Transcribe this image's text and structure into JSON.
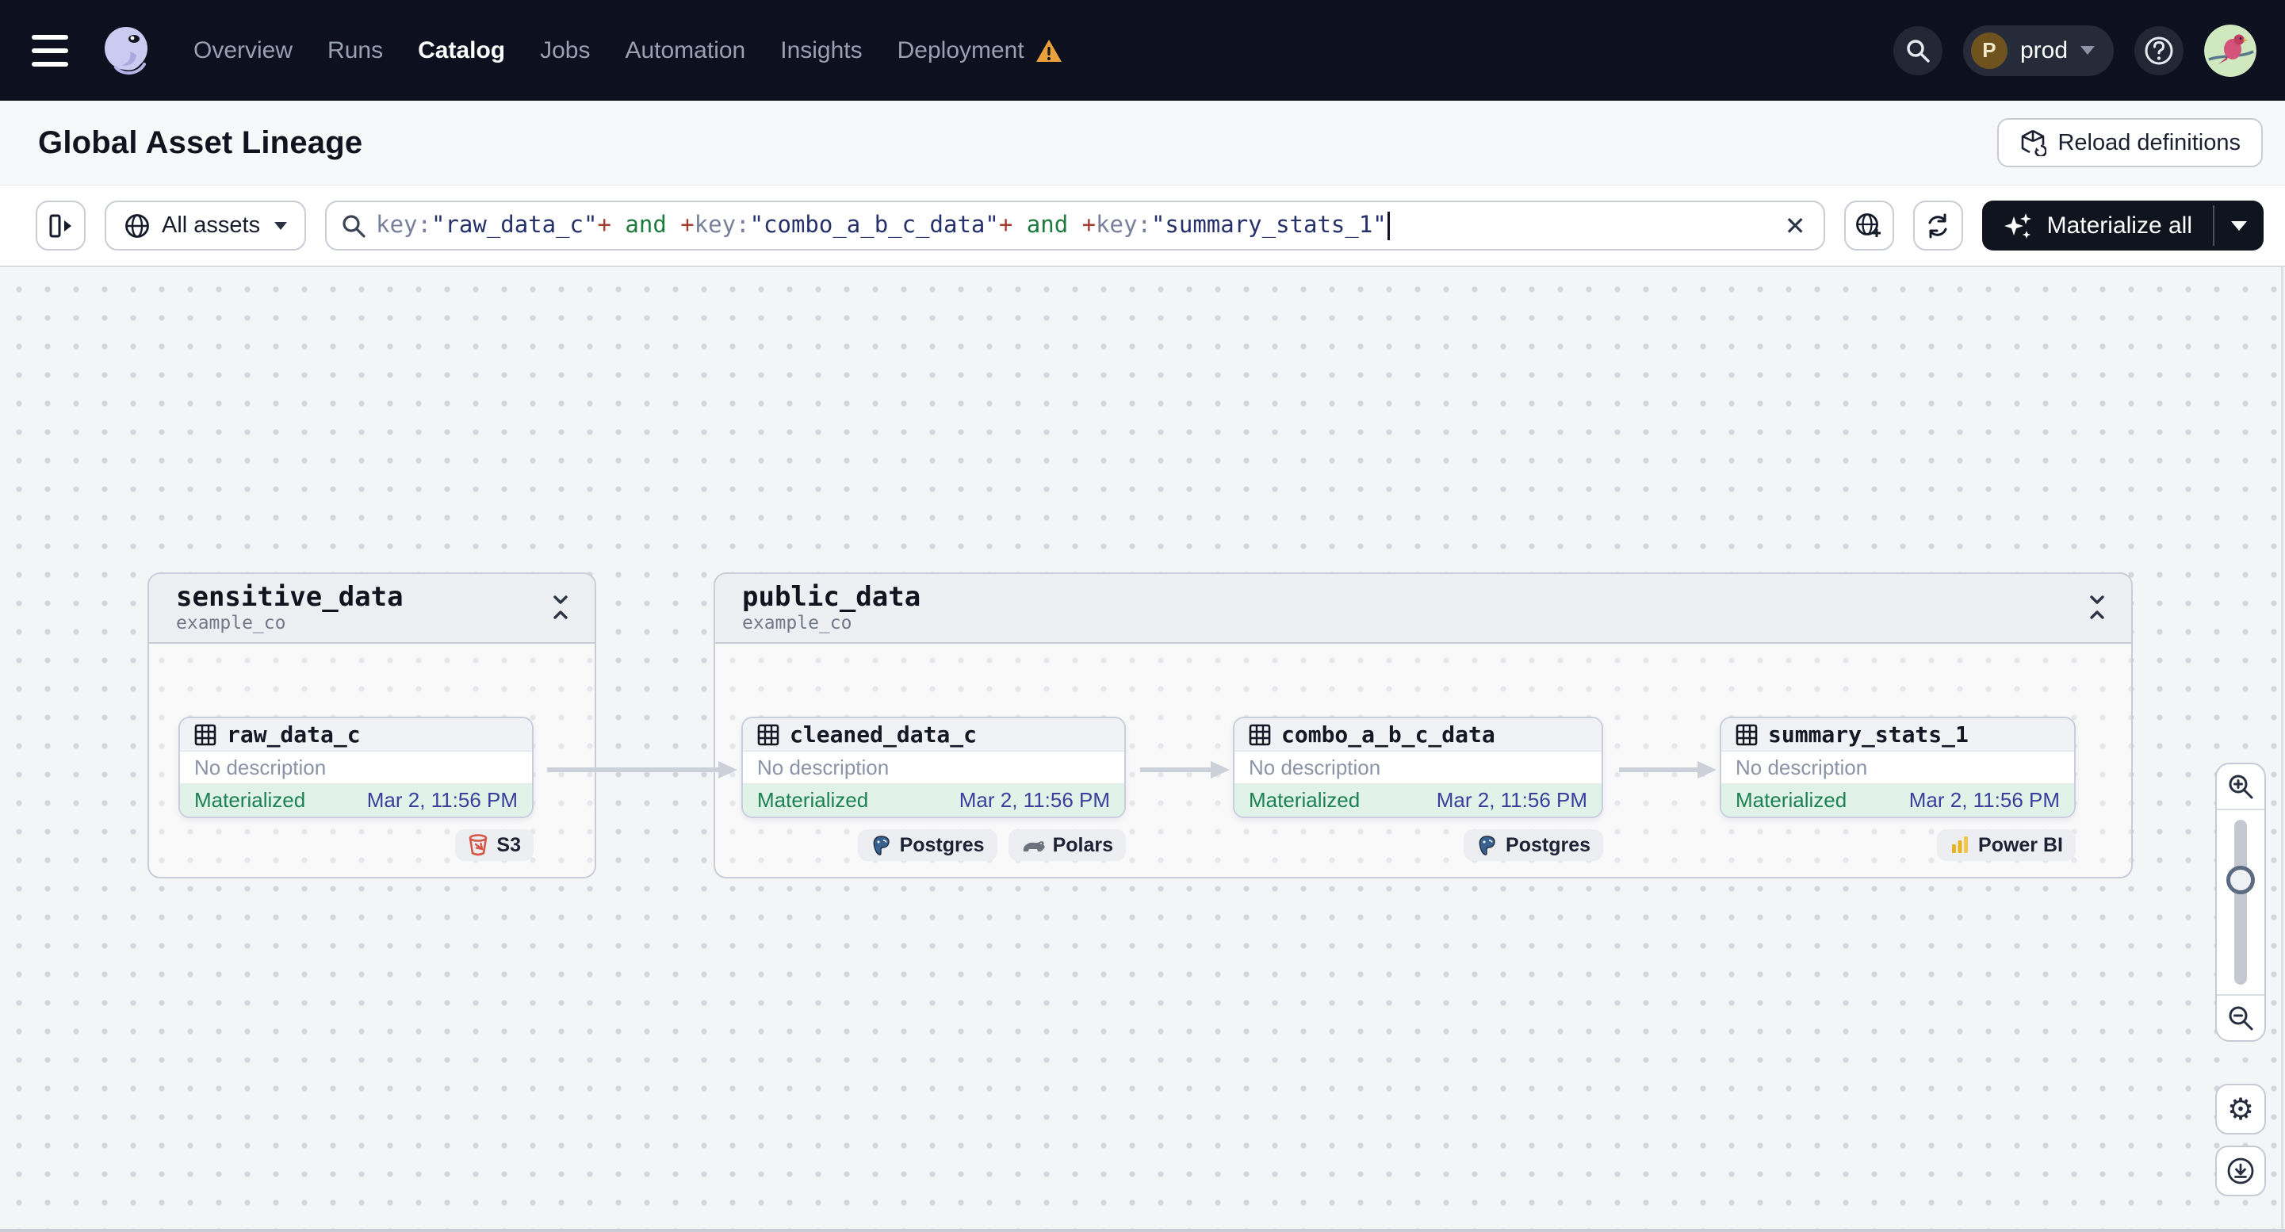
{
  "nav": {
    "items": [
      {
        "label": "Overview"
      },
      {
        "label": "Runs"
      },
      {
        "label": "Catalog"
      },
      {
        "label": "Jobs"
      },
      {
        "label": "Automation"
      },
      {
        "label": "Insights"
      },
      {
        "label": "Deployment"
      }
    ],
    "active_item": "Catalog",
    "deployment_has_warning": true,
    "env": {
      "initial": "P",
      "name": "prod"
    }
  },
  "header": {
    "title": "Global Asset Lineage",
    "reload_label": "Reload definitions"
  },
  "filter": {
    "scope_label": "All assets",
    "clear_glyph": "✕",
    "materialize_label": "Materialize all",
    "query_tokens": [
      {
        "text": "key:",
        "type": "key"
      },
      {
        "text": "\"raw_data_c\"",
        "type": "value"
      },
      {
        "text": "+",
        "type": "plus"
      },
      {
        "text": " and ",
        "type": "and"
      },
      {
        "text": "+",
        "type": "plus"
      },
      {
        "text": "key:",
        "type": "key"
      },
      {
        "text": "\"combo_a_b_c_data\"",
        "type": "value"
      },
      {
        "text": "+",
        "type": "plus"
      },
      {
        "text": " and ",
        "type": "and"
      },
      {
        "text": "+",
        "type": "plus"
      },
      {
        "text": "key:",
        "type": "key"
      },
      {
        "text": "\"summary_stats_1\"",
        "type": "value"
      }
    ]
  },
  "canvas": {
    "groups": [
      {
        "name": "sensitive_data",
        "repo": "example_co"
      },
      {
        "name": "public_data",
        "repo": "example_co"
      }
    ],
    "nodes": [
      {
        "name": "raw_data_c",
        "description": "No description",
        "status": "Materialized",
        "timestamp": "Mar 2, 11:56 PM",
        "badges": [
          {
            "label": "S3"
          }
        ]
      },
      {
        "name": "cleaned_data_c",
        "description": "No description",
        "status": "Materialized",
        "timestamp": "Mar 2, 11:56 PM",
        "badges": [
          {
            "label": "Postgres"
          },
          {
            "label": "Polars"
          }
        ]
      },
      {
        "name": "combo_a_b_c_data",
        "description": "No description",
        "status": "Materialized",
        "timestamp": "Mar 2, 11:56 PM",
        "badges": [
          {
            "label": "Postgres"
          }
        ]
      },
      {
        "name": "summary_stats_1",
        "description": "No description",
        "status": "Materialized",
        "timestamp": "Mar 2, 11:56 PM",
        "badges": [
          {
            "label": "Power BI"
          }
        ]
      }
    ],
    "zoom_controls": {
      "settings_glyph": "⚙"
    }
  },
  "colors": {
    "nav_bg": "#0d101e",
    "materialized_green": "#1d8152",
    "status_row_green": "#e1f3e9",
    "timestamp_indigo": "#3a3f9e",
    "warning_amber": "#e9a23b",
    "query_key": "#78809a",
    "query_value": "#26306b",
    "query_plus": "#a33d2f",
    "query_and": "#1e7a3f",
    "s3_red": "#d65745",
    "postgres_blue": "#39618f",
    "powerbi_yellow": "#e8b320"
  }
}
